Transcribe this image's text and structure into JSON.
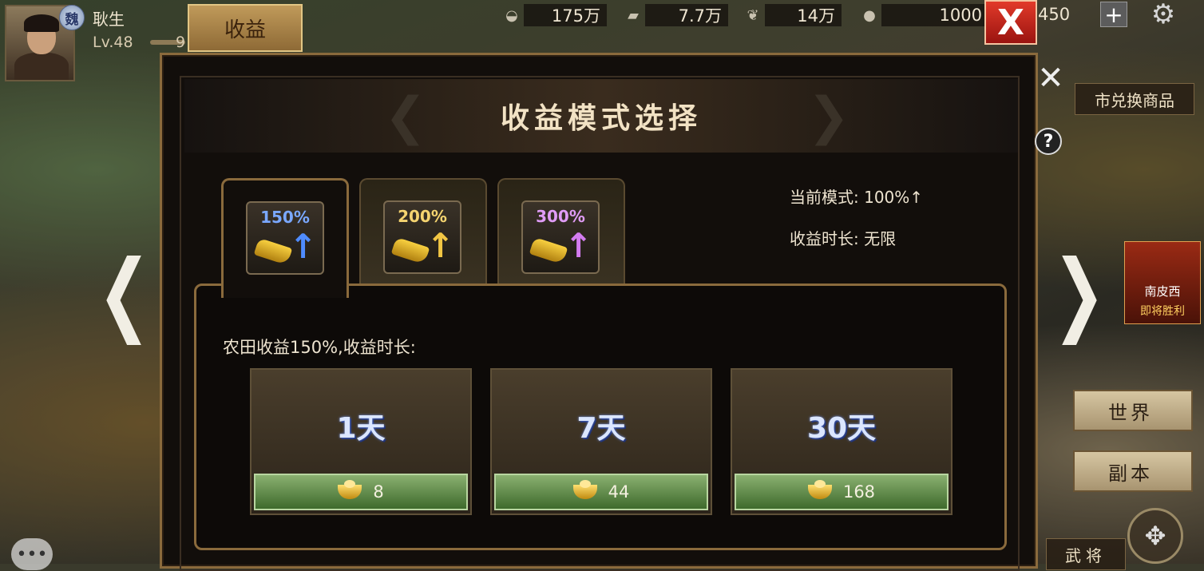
{
  "player": {
    "kingdom": "魏",
    "name": "耿生",
    "level": "Lv.48",
    "level_suffix": "9"
  },
  "hud": {
    "income_tab": "收益",
    "resources": [
      {
        "icon": "silver-ingot-icon",
        "value": "175万"
      },
      {
        "icon": "wood-log-icon",
        "value": "7.7万"
      },
      {
        "icon": "grain-icon",
        "value": "14万"
      },
      {
        "icon": "stone-icon",
        "value": "1000"
      }
    ],
    "gold": "450",
    "plus": "+",
    "close_label": "X"
  },
  "side": {
    "exchange": "市兑换商品",
    "world": "世界",
    "dungeon": "副本",
    "hero": "武将",
    "banner_city": "南皮西",
    "banner_text": "即将胜利",
    "help": "?"
  },
  "modal": {
    "title": "收益模式选择",
    "modes": [
      {
        "pct": "150%",
        "color": "#4f8cff",
        "active": true
      },
      {
        "pct": "200%",
        "color": "#f2c644",
        "active": false
      },
      {
        "pct": "300%",
        "color": "#d37cf0",
        "active": false
      }
    ],
    "current_mode_label": "当前模式: 100%↑",
    "duration_label": "收益时长: 无限",
    "content_label": "农田收益150%,收益时长:",
    "durations": [
      {
        "days": "1天",
        "cost": "8"
      },
      {
        "days": "7天",
        "cost": "44"
      },
      {
        "days": "30天",
        "cost": "168"
      }
    ]
  }
}
